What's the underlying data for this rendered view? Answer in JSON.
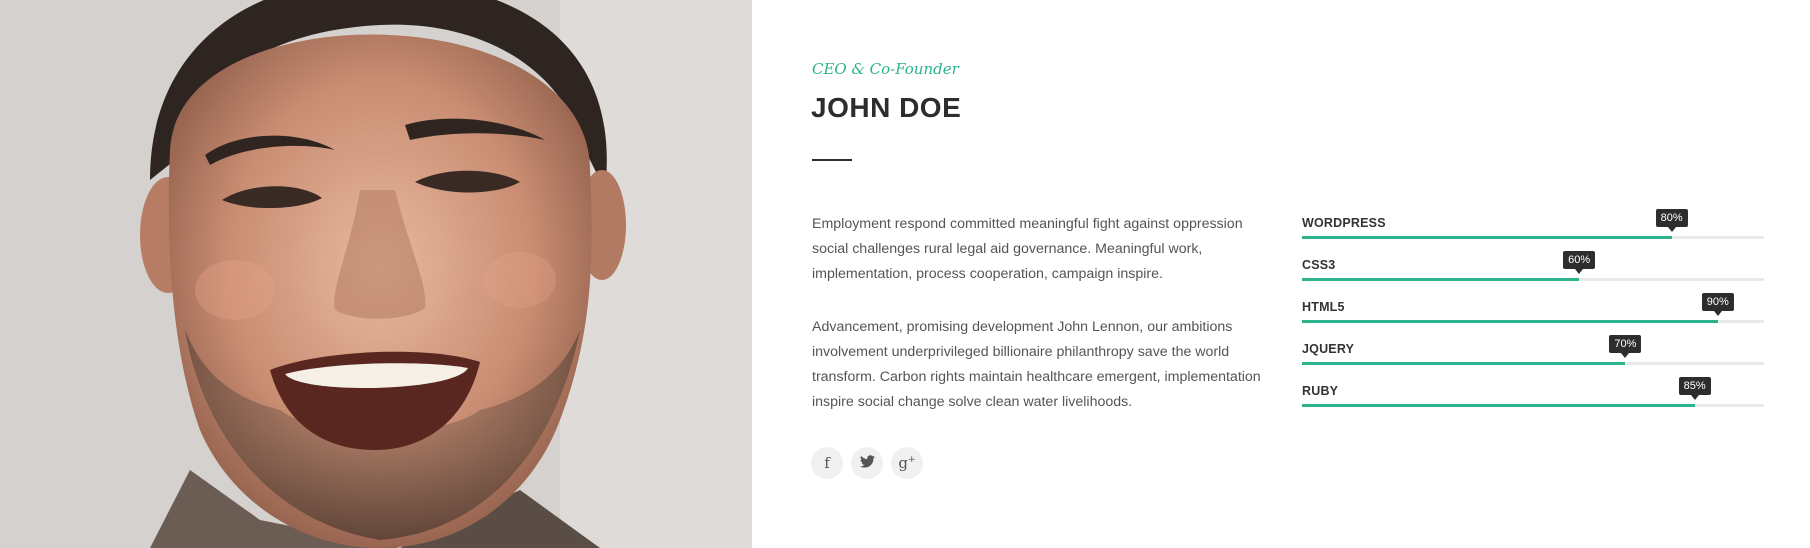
{
  "profile": {
    "role": "CEO & Co-Founder",
    "name": "JOHN DOE",
    "bio": [
      "Employment respond committed meaningful fight against oppression social challenges rural legal aid governance. Meaningful work, implementation, process cooperation, campaign inspire.",
      "Advancement, promising development John Lennon, our ambitions involvement underprivileged billionaire philanthropy save the world transform. Carbon rights maintain healthcare emergent, implementation inspire social change solve clean water livelihoods."
    ]
  },
  "social": [
    {
      "name": "facebook",
      "glyph": "f",
      "icon": "facebook-icon"
    },
    {
      "name": "twitter",
      "glyph": "🐦",
      "icon": "twitter-icon"
    },
    {
      "name": "google-plus",
      "glyph": "g",
      "sup": "+",
      "icon": "google-plus-icon"
    }
  ],
  "skills": [
    {
      "label": "WORDPRESS",
      "percent": 80,
      "percent_label": "80%"
    },
    {
      "label": "CSS3",
      "percent": 60,
      "percent_label": "60%"
    },
    {
      "label": "HTML5",
      "percent": 90,
      "percent_label": "90%"
    },
    {
      "label": "JQUERY",
      "percent": 70,
      "percent_label": "70%"
    },
    {
      "label": "RUBY",
      "percent": 85,
      "percent_label": "85%"
    }
  ],
  "colors": {
    "accent": "#2cb38d",
    "heading": "#2d2d2d",
    "body_text": "#555555",
    "track": "#e9e9e9"
  }
}
